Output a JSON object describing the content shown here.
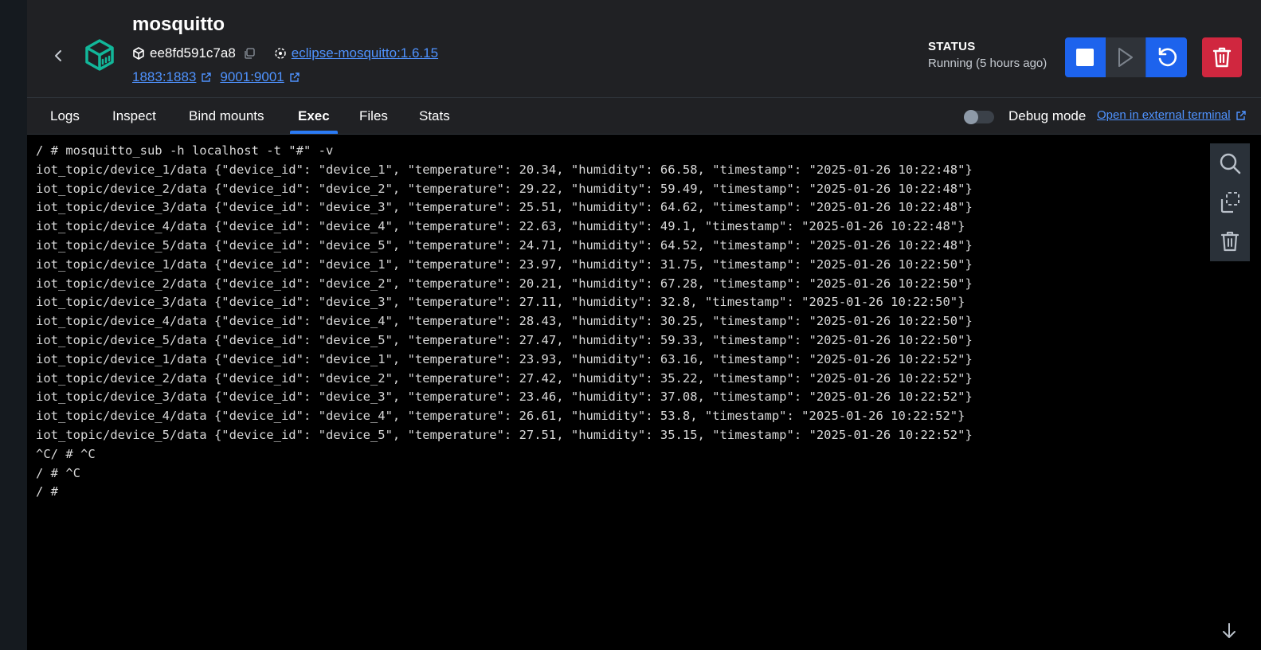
{
  "container": {
    "name": "mosquitto",
    "id": "ee8fd591c7a8",
    "image": "eclipse-mosquitto:1.6.15",
    "ports": [
      {
        "label": "1883:1883"
      },
      {
        "label": "9001:9001"
      }
    ]
  },
  "status": {
    "label": "STATUS",
    "value": "Running (5 hours ago)"
  },
  "tabs": [
    {
      "label": "Logs",
      "active": false
    },
    {
      "label": "Inspect",
      "active": false
    },
    {
      "label": "Bind mounts",
      "active": false
    },
    {
      "label": "Exec",
      "active": true
    },
    {
      "label": "Files",
      "active": false
    },
    {
      "label": "Stats",
      "active": false
    }
  ],
  "debug": {
    "label": "Debug mode",
    "enabled": false,
    "external_terminal_label": "Open in external terminal"
  },
  "colors": {
    "accent": "#1d63ed",
    "danger": "#d0273f",
    "link": "#4f93ff",
    "brand_icon": "#12b79a"
  },
  "terminal": {
    "lines": [
      "/ # mosquitto_sub -h localhost -t \"#\" -v",
      "iot_topic/device_1/data {\"device_id\": \"device_1\", \"temperature\": 20.34, \"humidity\": 66.58, \"timestamp\": \"2025-01-26 10:22:48\"}",
      "iot_topic/device_2/data {\"device_id\": \"device_2\", \"temperature\": 29.22, \"humidity\": 59.49, \"timestamp\": \"2025-01-26 10:22:48\"}",
      "iot_topic/device_3/data {\"device_id\": \"device_3\", \"temperature\": 25.51, \"humidity\": 64.62, \"timestamp\": \"2025-01-26 10:22:48\"}",
      "iot_topic/device_4/data {\"device_id\": \"device_4\", \"temperature\": 22.63, \"humidity\": 49.1, \"timestamp\": \"2025-01-26 10:22:48\"}",
      "iot_topic/device_5/data {\"device_id\": \"device_5\", \"temperature\": 24.71, \"humidity\": 64.52, \"timestamp\": \"2025-01-26 10:22:48\"}",
      "iot_topic/device_1/data {\"device_id\": \"device_1\", \"temperature\": 23.97, \"humidity\": 31.75, \"timestamp\": \"2025-01-26 10:22:50\"}",
      "iot_topic/device_2/data {\"device_id\": \"device_2\", \"temperature\": 20.21, \"humidity\": 67.28, \"timestamp\": \"2025-01-26 10:22:50\"}",
      "iot_topic/device_3/data {\"device_id\": \"device_3\", \"temperature\": 27.11, \"humidity\": 32.8, \"timestamp\": \"2025-01-26 10:22:50\"}",
      "iot_topic/device_4/data {\"device_id\": \"device_4\", \"temperature\": 28.43, \"humidity\": 30.25, \"timestamp\": \"2025-01-26 10:22:50\"}",
      "iot_topic/device_5/data {\"device_id\": \"device_5\", \"temperature\": 27.47, \"humidity\": 59.33, \"timestamp\": \"2025-01-26 10:22:50\"}",
      "iot_topic/device_1/data {\"device_id\": \"device_1\", \"temperature\": 23.93, \"humidity\": 63.16, \"timestamp\": \"2025-01-26 10:22:52\"}",
      "iot_topic/device_2/data {\"device_id\": \"device_2\", \"temperature\": 27.42, \"humidity\": 35.22, \"timestamp\": \"2025-01-26 10:22:52\"}",
      "iot_topic/device_3/data {\"device_id\": \"device_3\", \"temperature\": 23.46, \"humidity\": 37.08, \"timestamp\": \"2025-01-26 10:22:52\"}",
      "iot_topic/device_4/data {\"device_id\": \"device_4\", \"temperature\": 26.61, \"humidity\": 53.8, \"timestamp\": \"2025-01-26 10:22:52\"}",
      "iot_topic/device_5/data {\"device_id\": \"device_5\", \"temperature\": 27.51, \"humidity\": 35.15, \"timestamp\": \"2025-01-26 10:22:52\"}",
      "^C/ # ^C",
      "/ # ^C",
      "/ #"
    ]
  }
}
